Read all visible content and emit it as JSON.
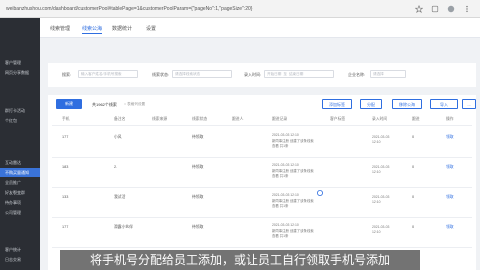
{
  "browser": {
    "url": "weibanzhushou.com/dashboard/customerPool#tablePage=1&customerPoolParam={\"pageNo\":1,\"pageSize\":20}"
  },
  "sidebar": {
    "items": [
      "客户管理",
      "网页分享数据",
      "群打卡活动",
      "个红包",
      "互动雷达",
      "不购买量通知",
      "全员推广",
      "好友裂变群",
      "待办事项",
      "公司管理",
      "客户统计",
      "日志交易"
    ],
    "active_index": 5
  },
  "tabs": [
    "线索管理",
    "线索公海",
    "数据统计",
    "设置"
  ],
  "active_tab": 1,
  "filters": {
    "search_label": "搜索:",
    "search_placeholder": "输入客户姓名/手机号搜索",
    "status_label": "线索状态:",
    "status_placeholder": "请选择线索状态",
    "entry_label": "录入时间:",
    "date_start": "开始日期",
    "date_sep": "至",
    "date_end": "结束日期",
    "company_label": "企业名称:",
    "company_value": "请选择"
  },
  "toolbar": {
    "new_label": "新建",
    "total_text": "共1962个线索",
    "total_sub": "○ 表格列设置",
    "actions": [
      "添加标签",
      "分配",
      "移除公海",
      "导入",
      "..."
    ]
  },
  "table": {
    "headers": [
      "手机",
      "备注名",
      "线索来源",
      "线索状态",
      "跟进人",
      "跟进记录",
      "客户标签",
      "录入时间",
      "跟进",
      "操作"
    ],
    "rows": [
      {
        "phone": "177",
        "name": "小风",
        "status": "待领取",
        "followup": [
          "2021-03-03 12:10",
          "新同事注册 创建了该条线索",
          "查看  共1条"
        ],
        "entry": [
          "2021-03-03",
          "12:10"
        ],
        "count": "0",
        "op": "领取"
      },
      {
        "phone": "183",
        "name": "2.",
        "status": "待领取",
        "followup": [
          "2021-03-03 12:10",
          "新同事注册 创建了该条线索",
          "查看  共1条"
        ],
        "entry": [
          "2021-03-03",
          "12:10"
        ],
        "count": "0",
        "op": "领取"
      },
      {
        "phone": "133",
        "name": "我试活",
        "status": "待领取",
        "followup": [
          "2021-03-03 12:10",
          "新同事注册 创建了该条线索",
          "查看  共1条"
        ],
        "entry": [
          "2021-03-03",
          "12:10"
        ],
        "count": "0",
        "op": "领取"
      },
      {
        "phone": "177",
        "name": "滑露小伙伴",
        "status": "待领取",
        "followup": [
          "2021-03-03 12:10",
          "新同事注册 创建了该条线索",
          "查看  共1条"
        ],
        "entry": [
          "2021-03-03",
          "12:10"
        ],
        "count": "0",
        "op": "领取"
      }
    ]
  },
  "subtitle": "将手机号分配给员工添加，或让员工自行领取手机号添加",
  "colors": {
    "accent": "#2f6ee0",
    "sidebar_bg": "#2b2e34",
    "active_side": "#3a73d8"
  }
}
